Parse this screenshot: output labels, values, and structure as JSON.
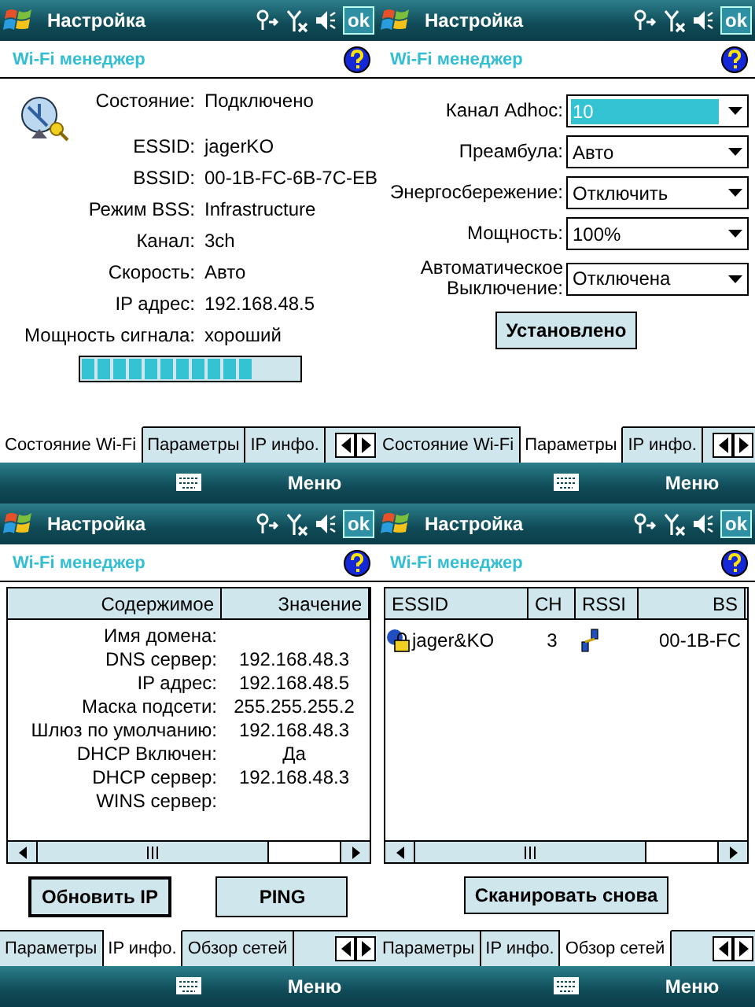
{
  "screens": [
    {
      "kind": "status",
      "title": "Настройка",
      "ok": "ok",
      "header": "Wi-Fi менеджер",
      "menu": "Меню",
      "rows": [
        {
          "label": "Состояние:",
          "value": "Подключено"
        },
        {
          "label": "ESSID:",
          "value": "jagerKO"
        },
        {
          "label": "BSSID:",
          "value": "00-1B-FC-6B-7C-EB"
        },
        {
          "label": "Режим BSS:",
          "value": "Infrastructure"
        },
        {
          "label": "Канал:",
          "value": "3ch"
        },
        {
          "label": "Скорость:",
          "value": "Авто"
        },
        {
          "label": "IP адрес:",
          "value": "192.168.48.5"
        },
        {
          "label": "Мощность сигнала:",
          "value": "хороший"
        }
      ],
      "signal": {
        "level": 0.78
      },
      "tabs": [
        {
          "label": "Состояние Wi-Fi",
          "selected": true
        },
        {
          "label": "Параметры",
          "selected": false
        },
        {
          "label": "IP инфо.",
          "selected": false
        }
      ]
    },
    {
      "kind": "settings",
      "title": "Настройка",
      "ok": "ok",
      "header": "Wi-Fi менеджер",
      "menu": "Меню",
      "fields": [
        {
          "label": "Канал Adhoc:",
          "value": "10",
          "selected": true
        },
        {
          "label": "Преамбула:",
          "value": "Авто",
          "selected": false
        },
        {
          "label": "Энергосбережение:",
          "value": "Отключить",
          "selected": false
        },
        {
          "label": "Мощность:",
          "value": "100%",
          "selected": false
        },
        {
          "label": "Автоматическое Выключение:",
          "value": "Отключена",
          "selected": false
        }
      ],
      "buttons": [
        {
          "label": "Установлено",
          "default": false
        }
      ],
      "tabs": [
        {
          "label": "Состояние Wi-Fi",
          "selected": false
        },
        {
          "label": "Параметры",
          "selected": true
        },
        {
          "label": "IP инфо.",
          "selected": false
        }
      ]
    },
    {
      "kind": "ipinfo",
      "title": "Настройка",
      "ok": "ok",
      "header": "Wi-Fi менеджер",
      "menu": "Меню",
      "columns": [
        "Содержимое",
        "Значение"
      ],
      "rows": [
        [
          "Имя домена:",
          ""
        ],
        [
          "DNS сервер:",
          "192.168.48.3"
        ],
        [
          "IP адрес:",
          "192.168.48.5"
        ],
        [
          "Маска подсети:",
          "255.255.255.2"
        ],
        [
          "Шлюз по умолчанию:",
          "192.168.48.3"
        ],
        [
          "DHCP Включен:",
          "Да"
        ],
        [
          "DHCP сервер:",
          "192.168.48.3"
        ],
        [
          "WINS сервер:",
          ""
        ]
      ],
      "buttons": [
        {
          "label": "Обновить IP",
          "default": true
        },
        {
          "label": "PING",
          "default": false
        }
      ],
      "tabs": [
        {
          "label": "Параметры",
          "selected": false
        },
        {
          "label": "IP инфо.",
          "selected": true
        },
        {
          "label": "Обзор сетей",
          "selected": false
        }
      ]
    },
    {
      "kind": "networks",
      "title": "Настройка",
      "ok": "ok",
      "header": "Wi-Fi менеджер",
      "menu": "Меню",
      "columns": [
        "ESSID",
        "CH",
        "RSSI",
        "BS"
      ],
      "rows": [
        {
          "essid": "jager&KO",
          "ch": "3",
          "bssid": "00-1B-FC"
        }
      ],
      "buttons": [
        {
          "label": "Сканировать снова",
          "default": false
        }
      ],
      "tabs": [
        {
          "label": "Параметры",
          "selected": false
        },
        {
          "label": "IP инфо.",
          "selected": false
        },
        {
          "label": "Обзор сетей",
          "selected": true
        }
      ]
    }
  ]
}
